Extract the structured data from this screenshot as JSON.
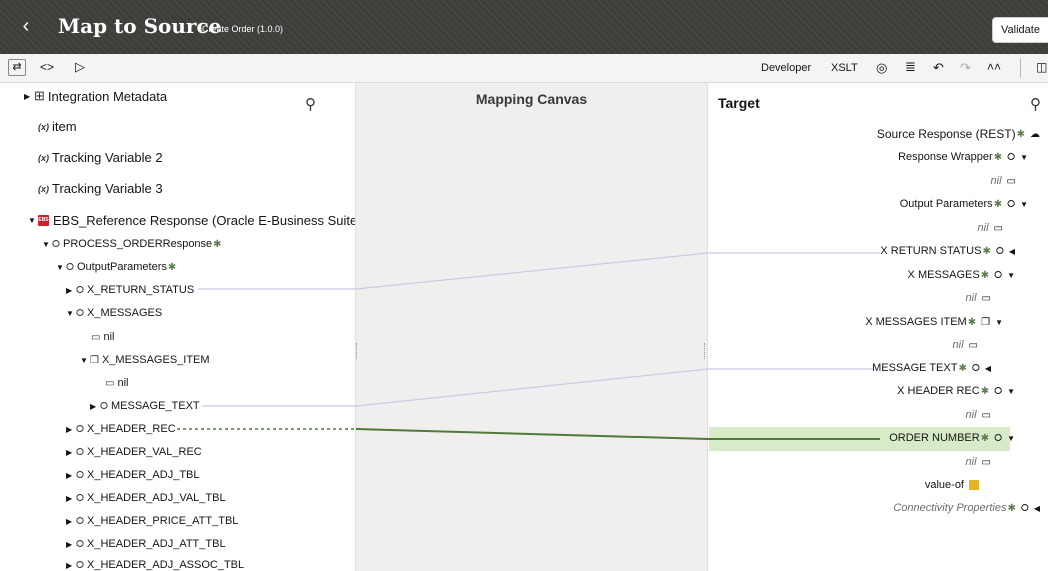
{
  "header": {
    "title": "Map to Source",
    "subtitle": "Create Order (1.0.0)",
    "validate_label": "Validate"
  },
  "toolbar": {
    "developer_label": "Developer",
    "xslt_label": "XSLT"
  },
  "canvas": {
    "title": "Mapping Canvas"
  },
  "source": {
    "items": [
      {
        "label": "Integration Metadata"
      },
      {
        "label": "item"
      },
      {
        "label": "Tracking Variable 2"
      },
      {
        "label": "Tracking Variable 3"
      },
      {
        "label": "EBS_Reference Response (Oracle E-Business Suite)"
      },
      {
        "label": "PROCESS_ORDERResponse"
      },
      {
        "label": "OutputParameters"
      },
      {
        "label": "X_RETURN_STATUS"
      },
      {
        "label": "X_MESSAGES"
      },
      {
        "label": "nil"
      },
      {
        "label": "X_MESSAGES_ITEM"
      },
      {
        "label": "nil"
      },
      {
        "label": "MESSAGE_TEXT"
      },
      {
        "label": "X_HEADER_REC"
      },
      {
        "label": "X_HEADER_VAL_REC"
      },
      {
        "label": "X_HEADER_ADJ_TBL"
      },
      {
        "label": "X_HEADER_ADJ_VAL_TBL"
      },
      {
        "label": "X_HEADER_PRICE_ATT_TBL"
      },
      {
        "label": "X_HEADER_ADJ_ATT_TBL"
      },
      {
        "label": "X_HEADER_ADJ_ASSOC_TBL"
      }
    ]
  },
  "target": {
    "title": "Target",
    "items": [
      {
        "label": "Source Response (REST)"
      },
      {
        "label": "Response Wrapper"
      },
      {
        "label": "nil"
      },
      {
        "label": "Output Parameters"
      },
      {
        "label": "nil"
      },
      {
        "label": "X RETURN STATUS"
      },
      {
        "label": "X MESSAGES"
      },
      {
        "label": "nil"
      },
      {
        "label": "X MESSAGES ITEM"
      },
      {
        "label": "nil"
      },
      {
        "label": "MESSAGE TEXT"
      },
      {
        "label": "X HEADER REC"
      },
      {
        "label": "nil"
      },
      {
        "label": "ORDER NUMBER"
      },
      {
        "label": "nil"
      },
      {
        "label": "value-of"
      },
      {
        "label": "Connectivity Properties"
      }
    ]
  },
  "colors": {
    "header_bg": "#3f3d3a",
    "mapped_line": "#4f7a3a",
    "link_line": "#c9c8e3",
    "highlight": "#d7ebc9"
  }
}
